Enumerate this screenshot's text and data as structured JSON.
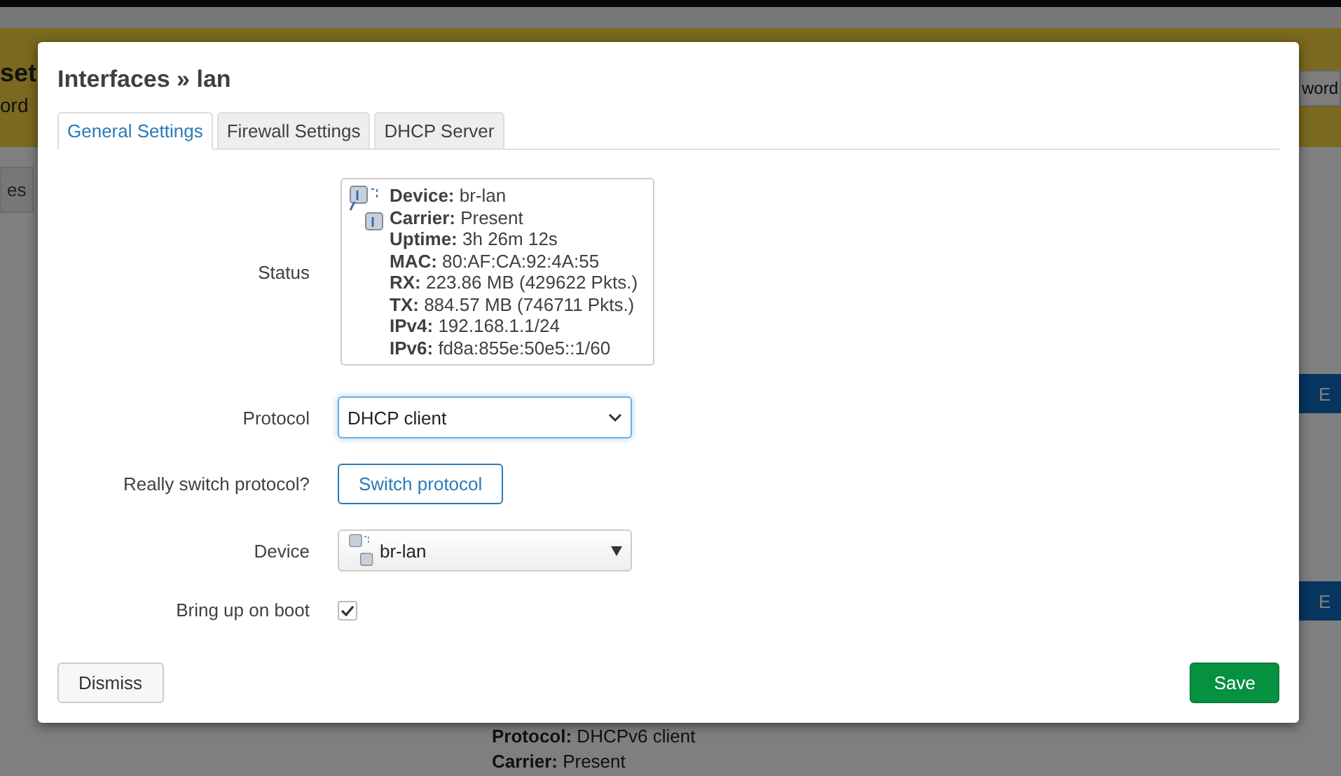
{
  "background": {
    "banner": {
      "title": "set",
      "text": "ord",
      "button": "word"
    },
    "tab": "es",
    "edit_buttons": [
      "E",
      "E"
    ],
    "status_lines": [
      "**Protocol:** DHCPv6 client",
      "**Carrier:** Present"
    ]
  },
  "dialog": {
    "title": "Interfaces » lan",
    "tabs": [
      {
        "label": "General Settings",
        "selected": true
      },
      {
        "label": "Firewall Settings",
        "selected": false
      },
      {
        "label": "DHCP Server",
        "selected": false
      }
    ],
    "status": {
      "label": "Status",
      "lines": [
        "**Device:** br-lan",
        "**Carrier:** Present",
        "**Uptime:** 3h 26m 12s",
        "**MAC:** 80:AF:CA:92:4A:55",
        "**RX:** 223.86 MB (429622 Pkts.)",
        "**TX:** 884.57 MB (746711 Pkts.)",
        "**IPv4:** 192.168.1.1/24",
        "**IPv6:** fd8a:855e:50e5::1/60"
      ]
    },
    "protocol": {
      "label": "Protocol",
      "value": "DHCP client"
    },
    "switch": {
      "label": "Really switch protocol?",
      "button": "Switch protocol"
    },
    "device": {
      "label": "Device",
      "value": "br-lan"
    },
    "boot": {
      "label": "Bring up on boot",
      "checked": true
    },
    "buttons": {
      "dismiss": "Dismiss",
      "save": "Save"
    }
  }
}
